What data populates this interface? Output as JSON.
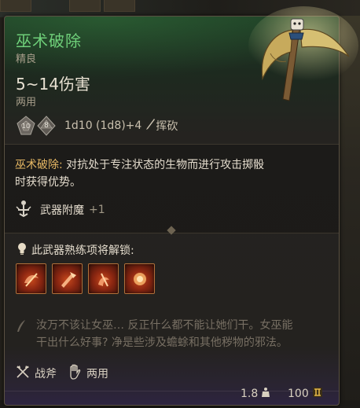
{
  "item": {
    "name": "巫术破除",
    "rarity": "精良",
    "damage": "5~14伤害",
    "handedness": "两用",
    "damage_formula": "1d10 (1d8)+4",
    "damage_type": "挥砍",
    "dice": [
      "10",
      "8"
    ]
  },
  "ability": {
    "name": "巫术破除:",
    "description_line1": " 对抗处于专注状态的生物而进行攻击掷骰",
    "description_line2": "时获得优势。",
    "enchant_label": "武器附魔",
    "enchant_bonus": "+1"
  },
  "proficiency": {
    "unlock_label": "此武器熟练项将解锁:",
    "actions": [
      "action-1-icon",
      "action-2-icon",
      "action-3-icon",
      "action-4-icon"
    ]
  },
  "lore": {
    "line1": "汝万不该让女巫… 反正什么都不能让她们干。女巫能",
    "line2": "干出什么好事? 净是些涉及蟾蜍和其他秽物的邪法。"
  },
  "properties": {
    "weapon_type": "战斧",
    "handedness": "两用"
  },
  "footer": {
    "weight": "1.8",
    "price": "100"
  },
  "colors": {
    "title": "#6fd07a",
    "highlight": "#e7b864",
    "lore": "#776f63"
  }
}
